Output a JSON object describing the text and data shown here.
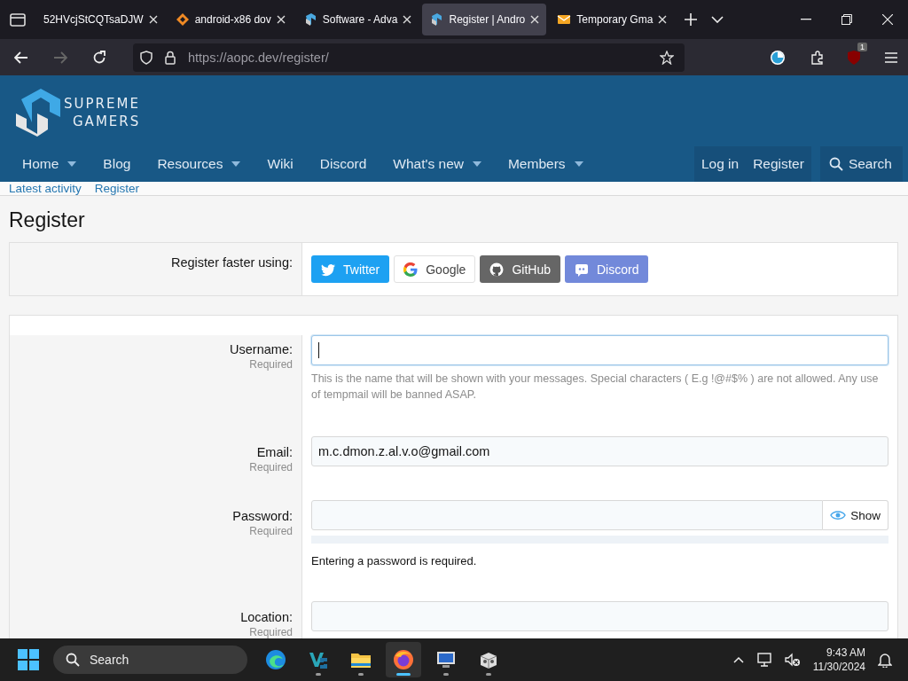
{
  "browser": {
    "tabs": [
      {
        "title": "52HVcjStCQTsaDJW",
        "selected": false
      },
      {
        "title": "android-x86 dov",
        "kind": "diamond",
        "selected": false
      },
      {
        "title": "Software - Adva",
        "kind": "logo",
        "selected": false
      },
      {
        "title": "Register | Andro",
        "kind": "logo",
        "selected": true
      },
      {
        "title": "Temporary Gma",
        "kind": "mail",
        "selected": false
      }
    ],
    "url": {
      "host": "https://aopc.dev",
      "path": "/register/"
    },
    "extension_badge": "1"
  },
  "site": {
    "logo": [
      "SUPREME",
      "GAMERS"
    ],
    "nav": [
      {
        "label": "Home",
        "dropdown": true
      },
      {
        "label": "Blog",
        "dropdown": false
      },
      {
        "label": "Resources",
        "dropdown": true
      },
      {
        "label": "Wiki",
        "dropdown": false
      },
      {
        "label": "Discord",
        "dropdown": false
      },
      {
        "label": "What's new",
        "dropdown": true
      },
      {
        "label": "Members",
        "dropdown": true
      }
    ],
    "account": [
      "Log in",
      "Register"
    ],
    "search": "Search",
    "breadcrumbs": [
      "Latest activity",
      "Register"
    ]
  },
  "page": {
    "title": "Register",
    "social": {
      "label": "Register faster using:",
      "buttons": [
        {
          "label": "Twitter",
          "kind": "twitter"
        },
        {
          "label": "Google",
          "kind": "google"
        },
        {
          "label": "GitHub",
          "kind": "github"
        },
        {
          "label": "Discord",
          "kind": "discord"
        }
      ]
    },
    "fields": [
      {
        "label": "Username:",
        "hint": "Required",
        "kind": "text",
        "focused": true,
        "explain": "This is the name that will be shown with your messages. Special characters ( E.g !@#$% ) are not allowed. Any use of tempmail will be banned ASAP."
      },
      {
        "label": "Email:",
        "hint": "Required",
        "kind": "text",
        "value": "m.c.dmon.z.al.v.o@gmail.com",
        "focused": false
      },
      {
        "label": "Password:",
        "hint": "Required",
        "kind": "password",
        "focused": false,
        "toggle": "Show",
        "strength": {
          "level": 0
        },
        "error": "Entering a password is required."
      },
      {
        "label": "Location:",
        "hint": "Required",
        "kind": "text",
        "focused": false
      }
    ]
  },
  "taskbar": {
    "search": "Search",
    "apps": [
      {
        "kind": "edge",
        "running": false
      },
      {
        "kind": "vs",
        "running": true
      },
      {
        "kind": "folder",
        "running": true
      },
      {
        "kind": "firefox",
        "running": true,
        "selected": true
      },
      {
        "kind": "monitor",
        "running": true
      },
      {
        "kind": "box",
        "running": true
      }
    ],
    "time": "9:43 AM",
    "date": "11/30/2024"
  }
}
